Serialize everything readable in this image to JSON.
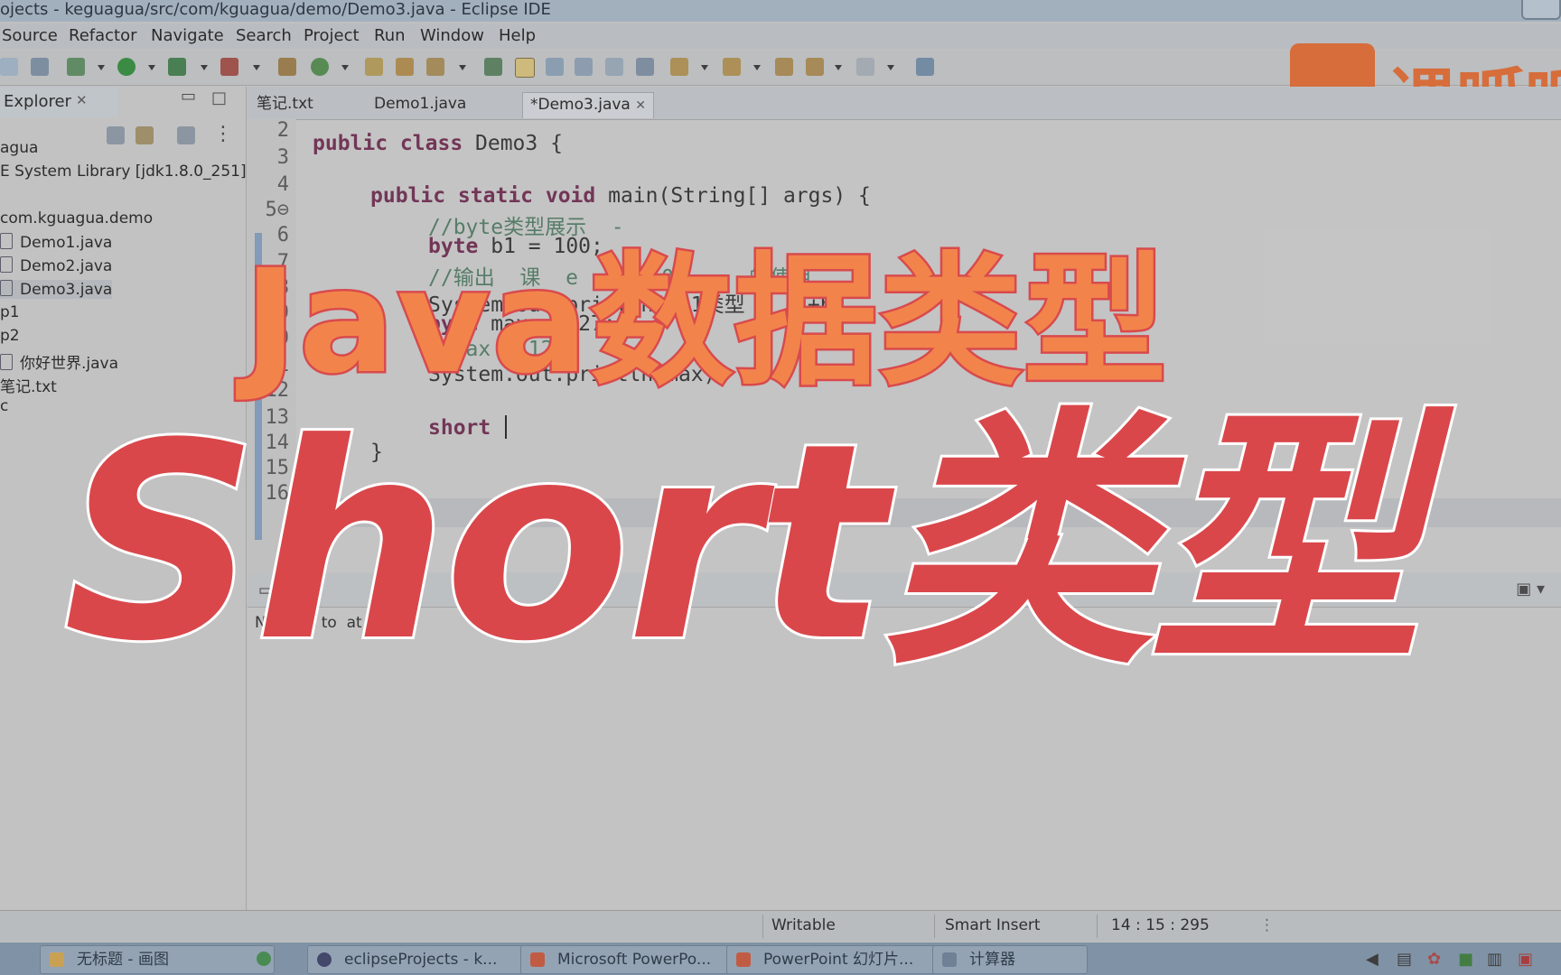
{
  "window": {
    "title": "ojects - keguagua/src/com/kguagua/demo/Demo3.java - Eclipse IDE"
  },
  "menu": [
    "Source",
    "Refactor",
    "Navigate",
    "Search",
    "Project",
    "Run",
    "Window",
    "Help"
  ],
  "explorer": {
    "tab_label": "Explorer",
    "items": [
      "agua",
      "E System Library [jdk1.8.0_251]",
      "com.kguagua.demo",
      "Demo1.java",
      "Demo2.java",
      "Demo3.java",
      "p1",
      "p2",
      "你好世界.java",
      "笔记.txt",
      "c"
    ]
  },
  "editor": {
    "tabs": [
      "笔记.txt",
      "Demo1.java",
      "*Demo3.java"
    ],
    "line_numbers": [
      "2",
      "3",
      "4",
      "5⊖",
      "6",
      "7",
      "8",
      "9",
      "10",
      "11",
      "12",
      "13",
      "14",
      "15",
      "16"
    ],
    "lines": {
      "l3_kw": "public class",
      "l3_rest": " Demo3 {",
      "l5_kw": "public static void",
      "l5_rest": " main(String[] args) {",
      "l6": "//byte类型展示  -",
      "l7_kw": "byte",
      "l7_rest": " b1 = 100;",
      "l8": "//输出  课  e  生  100     的使用",
      "l9": "System.out.println(\"b1类型 1  \"+b1",
      "l10_kw": "byte",
      "l10_rest": " max = 127;",
      "l11": "//max = 128;",
      "l12": "System.out.println(max);",
      "l14_kw": "short",
      "l15": "}"
    }
  },
  "console": {
    "tab_label": "ole",
    "message": "No  oles to  at t   s."
  },
  "status": {
    "writable": "Writable",
    "insert_mode": "Smart Insert",
    "position": "14 : 15 : 295"
  },
  "taskbar": {
    "tasks": [
      "无标题 - 画图",
      "eclipseProjects - k...",
      "Microsoft PowerPo...",
      "PowerPoint 幻灯片...",
      "计算器"
    ]
  },
  "logo": {
    "text": "课呱呱"
  },
  "overlay": {
    "headline1": "Java数据类型",
    "headline2": "Short类型"
  },
  "colors": {
    "headline1_fill": "#f2844b",
    "headline2_fill": "#d9474b",
    "logo": "#e0682e"
  }
}
